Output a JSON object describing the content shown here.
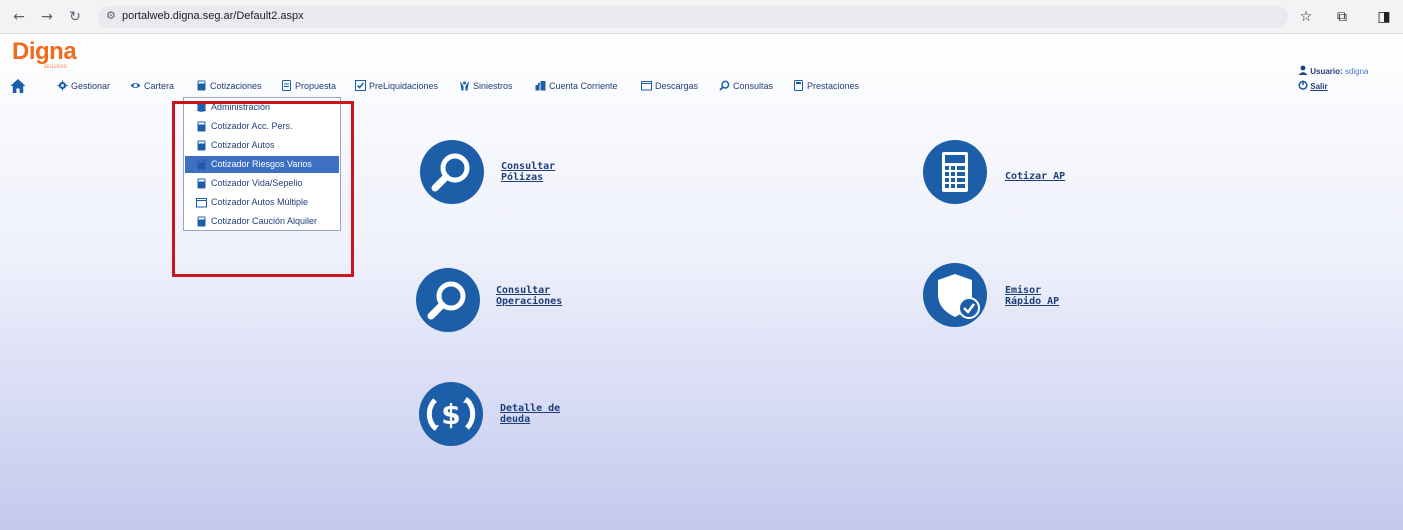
{
  "browser": {
    "url": "portalweb.digna.seg.ar/Default2.aspx",
    "back_icon": "arrow-left-icon",
    "forward_icon": "arrow-right-icon",
    "reload_icon": "reload-icon"
  },
  "header": {
    "logo_text": "Digna",
    "logo_sub": "SEGUROS",
    "user_label": "Usuario:",
    "user_name": "sdigna",
    "logout_label": "Salir"
  },
  "menu": {
    "items": [
      {
        "label": "Gestionar"
      },
      {
        "label": "Cartera"
      },
      {
        "label": "Cotizaciones"
      },
      {
        "label": "Propuesta"
      },
      {
        "label": "PreLiquidaciones"
      },
      {
        "label": "Siniestros"
      },
      {
        "label": "Cuenta Corriente"
      },
      {
        "label": "Descargas"
      },
      {
        "label": "Consultas"
      },
      {
        "label": "Prestaciones"
      }
    ]
  },
  "dropdown": {
    "items": [
      {
        "label": "Administración"
      },
      {
        "label": "Cotizador Acc. Pers."
      },
      {
        "label": "Cotizador Autos"
      },
      {
        "label": "Cotizador Riesgos Varios"
      },
      {
        "label": "Cotizador Vida/Sepelio"
      },
      {
        "label": "Cotizador Autos Múltiple"
      },
      {
        "label": "Cotizador Caución Alquiler"
      }
    ],
    "active_index": 3
  },
  "tiles": {
    "consultar_polizas": {
      "line1": "Consultar",
      "line2": "Pólizas"
    },
    "cotizar_ap": {
      "line1": "Cotizar AP"
    },
    "consultar_operaciones": {
      "line1": "Consultar",
      "line2": "Operaciones"
    },
    "emisor_rapido": {
      "line1": "Emisor",
      "line2": "Rápido AP"
    },
    "detalle_deuda": {
      "line1": "Detalle de",
      "line2": "deuda"
    }
  },
  "colors": {
    "brand_orange": "#f26a1b",
    "primary_blue": "#1d5ea8",
    "highlight_red": "#c8161d"
  }
}
